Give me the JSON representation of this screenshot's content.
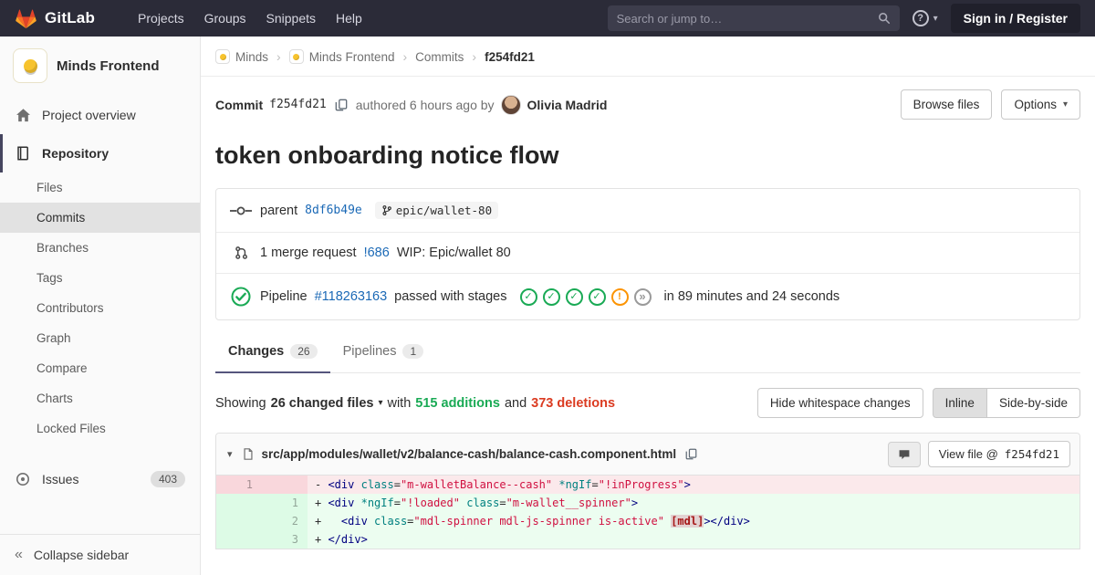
{
  "navbar": {
    "brand": "GitLab",
    "links": [
      "Projects",
      "Groups",
      "Snippets",
      "Help"
    ],
    "search_placeholder": "Search or jump to…",
    "help_label": "?",
    "sign_in": "Sign in / Register"
  },
  "sidebar": {
    "project_name": "Minds Frontend",
    "items": {
      "overview": "Project overview",
      "repository": "Repository",
      "issues": "Issues"
    },
    "repo_subitems": [
      "Files",
      "Commits",
      "Branches",
      "Tags",
      "Contributors",
      "Graph",
      "Compare",
      "Charts",
      "Locked Files"
    ],
    "active_subitem": "Commits",
    "issues_badge": "403",
    "collapse_label": "Collapse sidebar"
  },
  "breadcrumb": {
    "items": [
      {
        "label": "Minds",
        "icon": true,
        "current": false
      },
      {
        "label": "Minds Frontend",
        "icon": true,
        "current": false
      },
      {
        "label": "Commits",
        "icon": false,
        "current": false
      },
      {
        "label": "f254fd21",
        "icon": false,
        "current": true
      }
    ]
  },
  "commit": {
    "label": "Commit",
    "sha": "f254fd21",
    "authored": "authored 6 hours ago by",
    "author": "Olivia Madrid",
    "browse_button": "Browse files",
    "options_button": "Options",
    "title": "token onboarding notice flow"
  },
  "details": {
    "parent_label": "parent",
    "parent_sha": "8df6b49e",
    "branch_name": "epic/wallet-80",
    "mr_text": "1 merge request",
    "mr_link": "!686",
    "mr_title": "WIP: Epic/wallet 80",
    "pipeline_label": "Pipeline",
    "pipeline_link": "#118263163",
    "pipeline_status_text": "passed with stages",
    "pipeline_stages": [
      "passed",
      "passed",
      "passed",
      "passed",
      "warning",
      "skipped"
    ],
    "pipeline_duration": "in 89 minutes and 24 seconds"
  },
  "tabs": [
    {
      "label": "Changes",
      "badge": "26",
      "active": true
    },
    {
      "label": "Pipelines",
      "badge": "1",
      "active": false
    }
  ],
  "diff_summary": {
    "showing": "Showing",
    "files_dropdown": "26 changed files",
    "with_text": "with",
    "additions": "515 additions",
    "and_text": "and",
    "deletions": "373 deletions",
    "whitespace_button": "Hide whitespace changes",
    "inline_button": "Inline",
    "side_by_side_button": "Side-by-side"
  },
  "diff_file": {
    "path": "src/app/modules/wallet/v2/balance-cash/balance-cash.component.html",
    "view_file_label": "View file @",
    "view_file_sha": "f254fd21",
    "lines": [
      {
        "kind": "old",
        "old": "1",
        "new": "",
        "tokens": [
          [
            "- ",
            "x"
          ],
          [
            "<div",
            "nt"
          ],
          [
            " ",
            "x"
          ],
          [
            "class",
            "na"
          ],
          [
            "=",
            "x"
          ],
          [
            "\"m-walletBalance--cash\"",
            "s"
          ],
          [
            " ",
            "x"
          ],
          [
            "*ngIf",
            "na"
          ],
          [
            "=",
            "x"
          ],
          [
            "\"!inProgress\"",
            "s"
          ],
          [
            ">",
            "nt"
          ]
        ]
      },
      {
        "kind": "new",
        "old": "",
        "new": "1",
        "tokens": [
          [
            "+ ",
            "x"
          ],
          [
            "<div",
            "nt"
          ],
          [
            " ",
            "x"
          ],
          [
            "*ngIf",
            "na"
          ],
          [
            "=",
            "x"
          ],
          [
            "\"!loaded\"",
            "s"
          ],
          [
            " ",
            "x"
          ],
          [
            "class",
            "na"
          ],
          [
            "=",
            "x"
          ],
          [
            "\"m-wallet__spinner\"",
            "s"
          ],
          [
            ">",
            "nt"
          ]
        ]
      },
      {
        "kind": "new",
        "old": "",
        "new": "2",
        "tokens": [
          [
            "+   ",
            "x"
          ],
          [
            "<div",
            "nt"
          ],
          [
            " ",
            "x"
          ],
          [
            "class",
            "na"
          ],
          [
            "=",
            "x"
          ],
          [
            "\"mdl-spinner mdl-js-spinner is-active\"",
            "s"
          ],
          [
            " ",
            "x"
          ],
          [
            "[mdl]",
            "err"
          ],
          [
            "></div>",
            "nt"
          ]
        ]
      },
      {
        "kind": "new",
        "old": "",
        "new": "3",
        "tokens": [
          [
            "+ ",
            "x"
          ],
          [
            "</div>",
            "nt"
          ]
        ]
      }
    ]
  },
  "icons": {
    "caret_down": "▾",
    "breadcrumb_separator": "›",
    "collapse_chevrons": "«",
    "file_collapse": "▾",
    "project_logo": "lightbulb",
    "stage_glyphs": {
      "passed": "✓",
      "warning": "!",
      "skipped": "»"
    }
  },
  "colors": {
    "navbar_bg": "#2b2b38",
    "link_blue": "#1b69b6",
    "success_green": "#1aaa55",
    "warning_orange": "#fc9403",
    "skipped_gray": "#9a9a9a",
    "deletions_red": "#db3b21",
    "brand_orange": "#fc6d26"
  }
}
